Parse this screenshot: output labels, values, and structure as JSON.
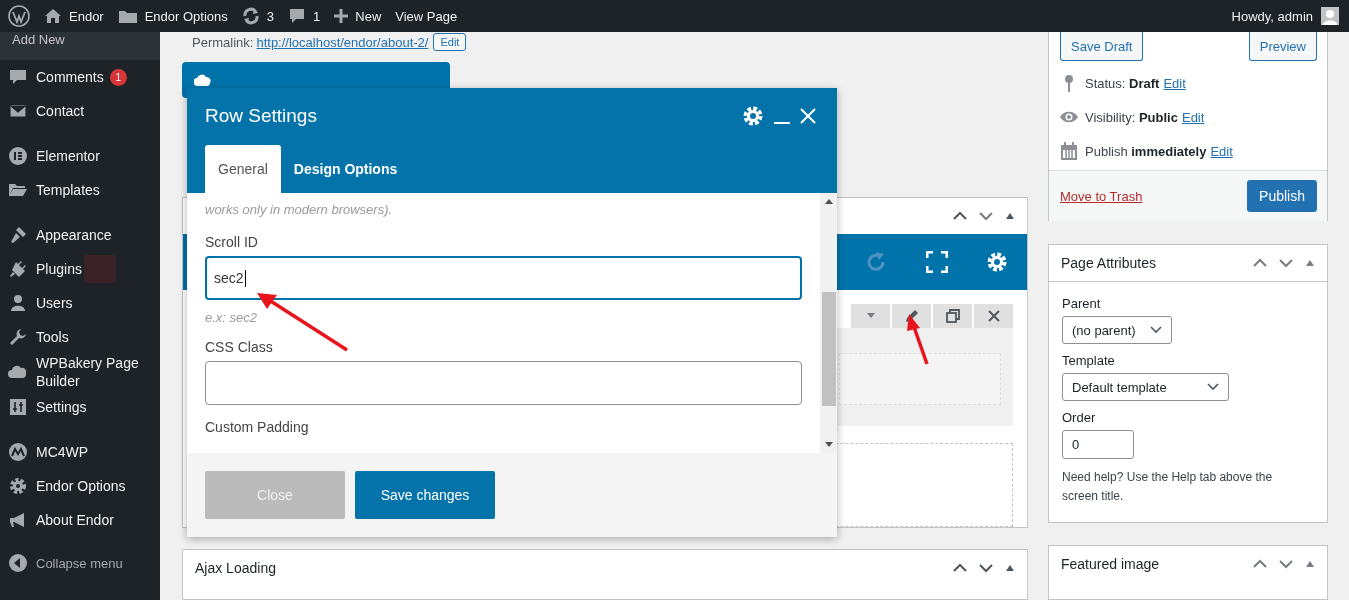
{
  "admin_bar": {
    "items": [
      {
        "kind": "logo"
      },
      {
        "kind": "home",
        "label": "Endor"
      },
      {
        "kind": "folder",
        "label": "Endor Options"
      },
      {
        "kind": "updates",
        "label": "3"
      },
      {
        "kind": "comments",
        "label": "1"
      },
      {
        "kind": "new",
        "label": "New"
      },
      {
        "kind": "plain",
        "label": "View Page"
      }
    ],
    "greeting": "Howdy, admin"
  },
  "sidebar": {
    "submenu_item": "Add New",
    "groups": [
      [
        {
          "kind": "comment",
          "label": "Comments",
          "badge": "1"
        },
        {
          "kind": "mail",
          "label": "Contact"
        }
      ],
      [
        {
          "kind": "elementor",
          "label": "Elementor"
        },
        {
          "kind": "folder",
          "label": "Templates"
        }
      ],
      [
        {
          "kind": "brush",
          "label": "Appearance"
        },
        {
          "kind": "plug",
          "label": "Plugins",
          "redacted": true
        },
        {
          "kind": "user",
          "label": "Users"
        },
        {
          "kind": "wrench",
          "label": "Tools"
        },
        {
          "kind": "cloud",
          "label": "WPBakery Page Builder"
        },
        {
          "kind": "sliders",
          "label": "Settings"
        }
      ],
      [
        {
          "kind": "mc4wp",
          "label": "MC4WP"
        },
        {
          "kind": "gear",
          "label": "Endor Options"
        },
        {
          "kind": "megaphone",
          "label": "About Endor"
        }
      ]
    ],
    "collapse": "Collapse menu"
  },
  "permalink": {
    "label": "Permalink:",
    "url": "http://localhost/endor/about-2/",
    "button": "Edit"
  },
  "ajax_panel": {
    "title": "Ajax Loading"
  },
  "modal": {
    "title": "Row Settings",
    "tabs": [
      {
        "label": "General",
        "selected": true
      },
      {
        "label": "Design Options",
        "selected": false
      }
    ],
    "help_text": "works only in modern browsers).",
    "fields": [
      {
        "label": "Scroll ID",
        "value": "sec2",
        "focused": true,
        "hint": "e.x: sec2"
      },
      {
        "label": "CSS Class",
        "focused": false
      }
    ],
    "next_label": "Custom Padding",
    "buttons": [
      {
        "label": "Close",
        "primary": false,
        "disabled": true
      },
      {
        "label": "Save changes",
        "primary": true,
        "disabled": false
      }
    ]
  },
  "publish_box": {
    "buttons": [
      "Save Draft",
      "Preview"
    ],
    "meta": [
      {
        "kind": "pin",
        "label": "Status:",
        "value": "Draft",
        "link": "Edit"
      },
      {
        "kind": "eye",
        "label": "Visibility:",
        "value": "Public",
        "link": "Edit"
      },
      {
        "kind": "calendar",
        "label": "Publish",
        "value": "immediately",
        "link": "Edit"
      }
    ],
    "trash": "Move to Trash",
    "publish": "Publish"
  },
  "page_attributes": {
    "title": "Page Attributes",
    "fields": [
      {
        "kind": "select",
        "label": "Parent",
        "value": "(no parent)"
      },
      {
        "kind": "select",
        "label": "Template",
        "value": "Default template"
      },
      {
        "kind": "input",
        "label": "Order",
        "value": "0"
      }
    ],
    "help": "Need help? Use the Help tab above the screen title."
  },
  "featured_image": {
    "title": "Featured image"
  }
}
